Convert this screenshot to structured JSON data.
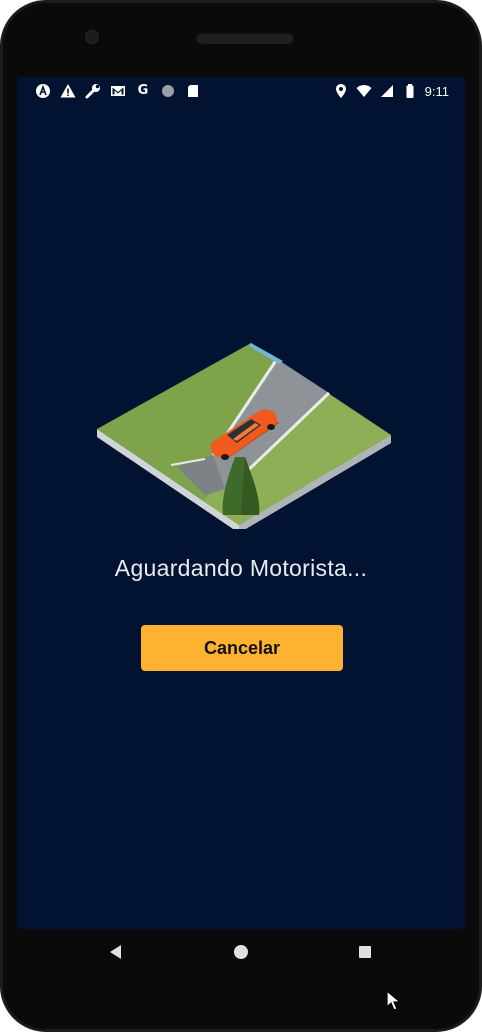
{
  "status_bar": {
    "time": "9:11",
    "left_icons": [
      "app-a-icon",
      "warning-icon",
      "wrench-icon",
      "gmail-icon",
      "google-g-icon",
      "circle-icon",
      "sd-card-icon"
    ],
    "google_g_label": "G",
    "right_icons": [
      "location-icon",
      "wifi-icon",
      "signal-icon",
      "battery-icon"
    ]
  },
  "main": {
    "waiting_text": "Aguardando Motorista...",
    "cancel_label": "Cancelar"
  },
  "colors": {
    "screen_background": "#011330",
    "button": "#fdb330",
    "car": "#f15a1f"
  },
  "nav_bar": {
    "icons": [
      "back-icon",
      "home-icon",
      "recents-icon"
    ]
  }
}
